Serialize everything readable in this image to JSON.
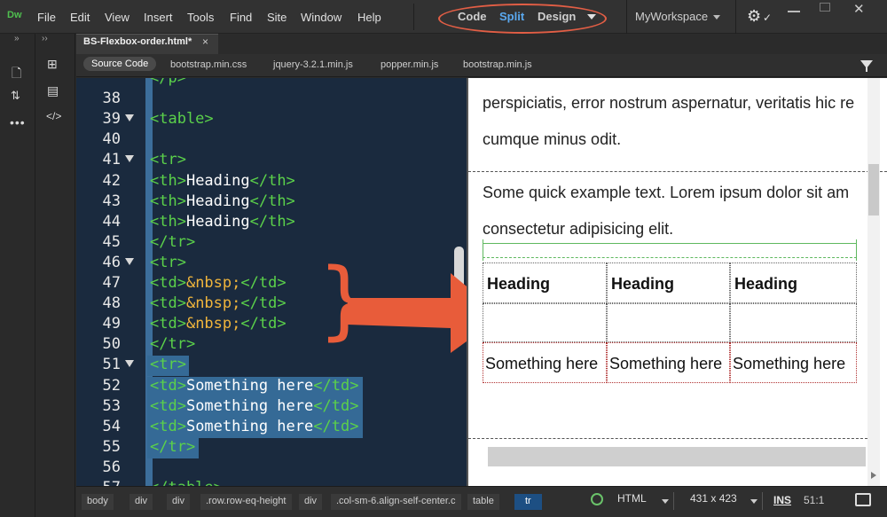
{
  "menubar": {
    "logo": "Dw",
    "items": [
      "File",
      "Edit",
      "View",
      "Insert",
      "Tools",
      "Find",
      "Site",
      "Window",
      "Help"
    ],
    "view_modes": [
      "Code",
      "Split",
      "Design"
    ],
    "active_view": "Split",
    "workspace": "MyWorkspace"
  },
  "tabs": {
    "document": "BS-Flexbox-order.html*",
    "close": "×",
    "related_files": [
      "Source Code",
      "bootstrap.min.css",
      "jquery-3.2.1.min.js",
      "popper.min.js",
      "bootstrap.min.js"
    ],
    "active_related": "Source Code"
  },
  "code": {
    "lines": [
      {
        "n": "",
        "fold": false,
        "parts": [
          [
            "tag",
            "</p>"
          ]
        ]
      },
      {
        "n": "38",
        "fold": false,
        "parts": []
      },
      {
        "n": "39",
        "fold": true,
        "parts": [
          [
            "tag",
            "<table>"
          ]
        ]
      },
      {
        "n": "40",
        "fold": false,
        "parts": []
      },
      {
        "n": "41",
        "fold": true,
        "parts": [
          [
            "tag",
            "<tr>"
          ]
        ]
      },
      {
        "n": "42",
        "fold": false,
        "parts": [
          [
            "tag",
            "<th>"
          ],
          [
            "txt",
            "Heading"
          ],
          [
            "tag",
            "</th>"
          ]
        ]
      },
      {
        "n": "43",
        "fold": false,
        "parts": [
          [
            "tag",
            "<th>"
          ],
          [
            "txt",
            "Heading"
          ],
          [
            "tag",
            "</th>"
          ]
        ]
      },
      {
        "n": "44",
        "fold": false,
        "parts": [
          [
            "tag",
            "<th>"
          ],
          [
            "txt",
            "Heading"
          ],
          [
            "tag",
            "</th>"
          ]
        ]
      },
      {
        "n": "45",
        "fold": false,
        "parts": [
          [
            "tag",
            "</tr>"
          ]
        ]
      },
      {
        "n": "46",
        "fold": true,
        "parts": [
          [
            "tag",
            "<tr>"
          ]
        ]
      },
      {
        "n": "47",
        "fold": false,
        "parts": [
          [
            "tag",
            "<td>"
          ],
          [
            "ent",
            "&nbsp;"
          ],
          [
            "tag",
            "</td>"
          ]
        ]
      },
      {
        "n": "48",
        "fold": false,
        "parts": [
          [
            "tag",
            "<td>"
          ],
          [
            "ent",
            "&nbsp;"
          ],
          [
            "tag",
            "</td>"
          ]
        ]
      },
      {
        "n": "49",
        "fold": false,
        "parts": [
          [
            "tag",
            "<td>"
          ],
          [
            "ent",
            "&nbsp;"
          ],
          [
            "tag",
            "</td>"
          ]
        ]
      },
      {
        "n": "50",
        "fold": false,
        "parts": [
          [
            "tag",
            "</tr>"
          ]
        ]
      },
      {
        "n": "51",
        "fold": true,
        "sel": true,
        "parts": [
          [
            "tag",
            "<tr>"
          ]
        ]
      },
      {
        "n": "52",
        "fold": false,
        "sel": true,
        "parts": [
          [
            "tag",
            "<td>"
          ],
          [
            "txt",
            "Something here"
          ],
          [
            "tag",
            "</td>"
          ]
        ]
      },
      {
        "n": "53",
        "fold": false,
        "sel": true,
        "parts": [
          [
            "tag",
            "<td>"
          ],
          [
            "txt",
            "Something here"
          ],
          [
            "tag",
            "</td>"
          ]
        ]
      },
      {
        "n": "54",
        "fold": false,
        "sel": true,
        "parts": [
          [
            "tag",
            "<td>"
          ],
          [
            "txt",
            "Something here"
          ],
          [
            "tag",
            "</td>"
          ]
        ]
      },
      {
        "n": "55",
        "fold": false,
        "sel": true,
        "parts": [
          [
            "tag",
            "</tr>"
          ]
        ]
      },
      {
        "n": "56",
        "fold": false,
        "parts": []
      },
      {
        "n": "57",
        "fold": false,
        "parts": [
          [
            "tag",
            "</table>"
          ]
        ]
      }
    ]
  },
  "preview": {
    "para1_line1": "perspiciatis, error nostrum aspernatur, veritatis hic re",
    "para1_line2": "cumque minus odit.",
    "para2_line1": "Some quick example text. Lorem ipsum dolor sit am",
    "para2_line2": "consectetur adipisicing elit.",
    "table": {
      "headers": [
        "Heading",
        "Heading",
        "Heading"
      ],
      "row_blank": [
        "",
        "",
        ""
      ],
      "row_text": [
        "Something here",
        "Something here",
        "Something here"
      ]
    }
  },
  "statusbar": {
    "breadcrumbs": [
      "body",
      "div",
      "div",
      ".row.row-eq-height",
      "div",
      ".col-sm-6.align-self-center.c",
      "table",
      "tr"
    ],
    "active_crumb": "tr",
    "doc_type": "HTML",
    "window_size": "431 x 423",
    "ins": "INS",
    "cursor": "51:1"
  },
  "colors": {
    "annotation": "#e85c3a",
    "tag": "#5bd14a",
    "entity": "#f0b53c",
    "selection": "#356a96",
    "active_view": "#5aa9f0"
  }
}
